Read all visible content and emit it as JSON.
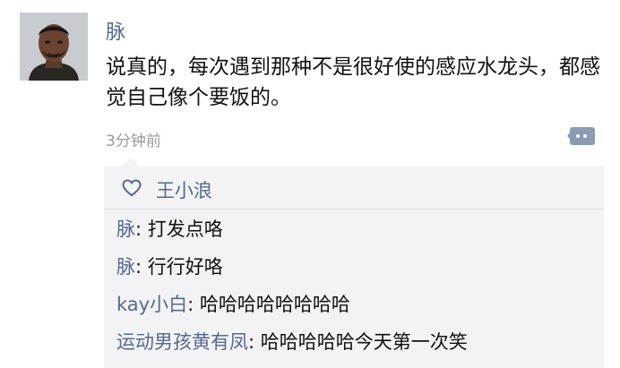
{
  "post": {
    "author": "脉",
    "content": "说真的，每次遇到那种不是很好使的感应水龙头，都感觉自己像个要饭的。",
    "time": "3分钟前"
  },
  "likes": {
    "names": "王小浪"
  },
  "comments": [
    {
      "author": "脉",
      "sep": ": ",
      "text": "打发点咯"
    },
    {
      "author": "脉",
      "sep": ": ",
      "text": "行行好咯"
    },
    {
      "author": "kay小白",
      "sep": ": ",
      "text": "哈哈哈哈哈哈哈哈"
    },
    {
      "author": "运动男孩黄有凤",
      "sep": ": ",
      "text": "哈哈哈哈哈今天第一次笑"
    }
  ],
  "icons": {
    "avatar": "avatar-photo",
    "like": "heart-outline-icon",
    "comment": "comment-bubble-icon"
  },
  "colors": {
    "link": "#55698f",
    "panel": "#f3f3f5",
    "timestamp": "#9a9a9a"
  }
}
